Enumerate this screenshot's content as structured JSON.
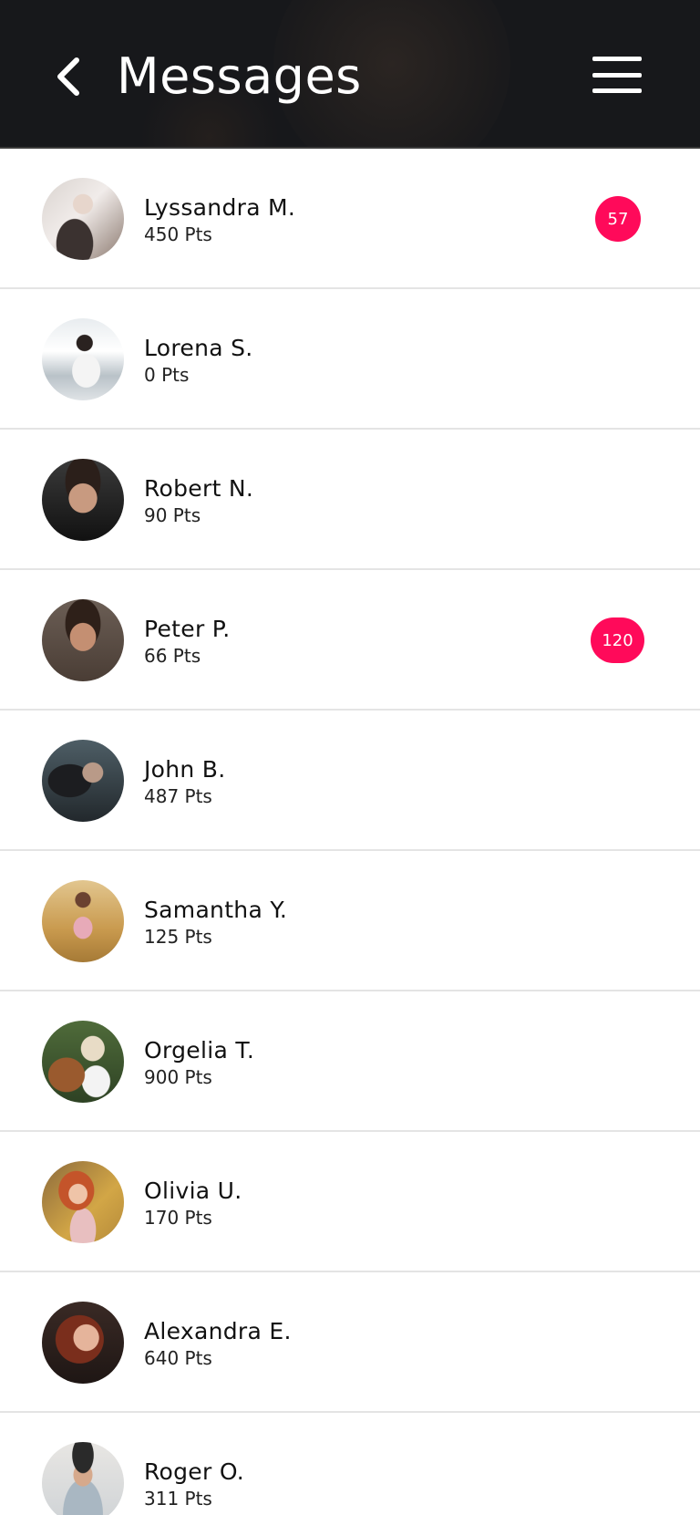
{
  "header": {
    "title": "Messages",
    "back_icon": "chevron-left-icon",
    "menu_icon": "hamburger-menu-icon"
  },
  "colors": {
    "header_bg": "#17181b",
    "badge": "#ff0a5a",
    "divider": "#e4e4e4"
  },
  "contacts": [
    {
      "name": "Lyssandra M.",
      "points": "450 Pts",
      "badge": "57"
    },
    {
      "name": "Lorena S.",
      "points": "0 Pts",
      "badge": ""
    },
    {
      "name": "Robert N.",
      "points": "90 Pts",
      "badge": ""
    },
    {
      "name": "Peter P.",
      "points": "66 Pts",
      "badge": "120"
    },
    {
      "name": "John B.",
      "points": "487 Pts",
      "badge": ""
    },
    {
      "name": "Samantha Y.",
      "points": "125 Pts",
      "badge": ""
    },
    {
      "name": "Orgelia T.",
      "points": "900 Pts",
      "badge": ""
    },
    {
      "name": "Olivia U.",
      "points": "170 Pts",
      "badge": ""
    },
    {
      "name": "Alexandra E.",
      "points": "640 Pts",
      "badge": ""
    },
    {
      "name": "Roger O.",
      "points": "311 Pts",
      "badge": ""
    }
  ]
}
